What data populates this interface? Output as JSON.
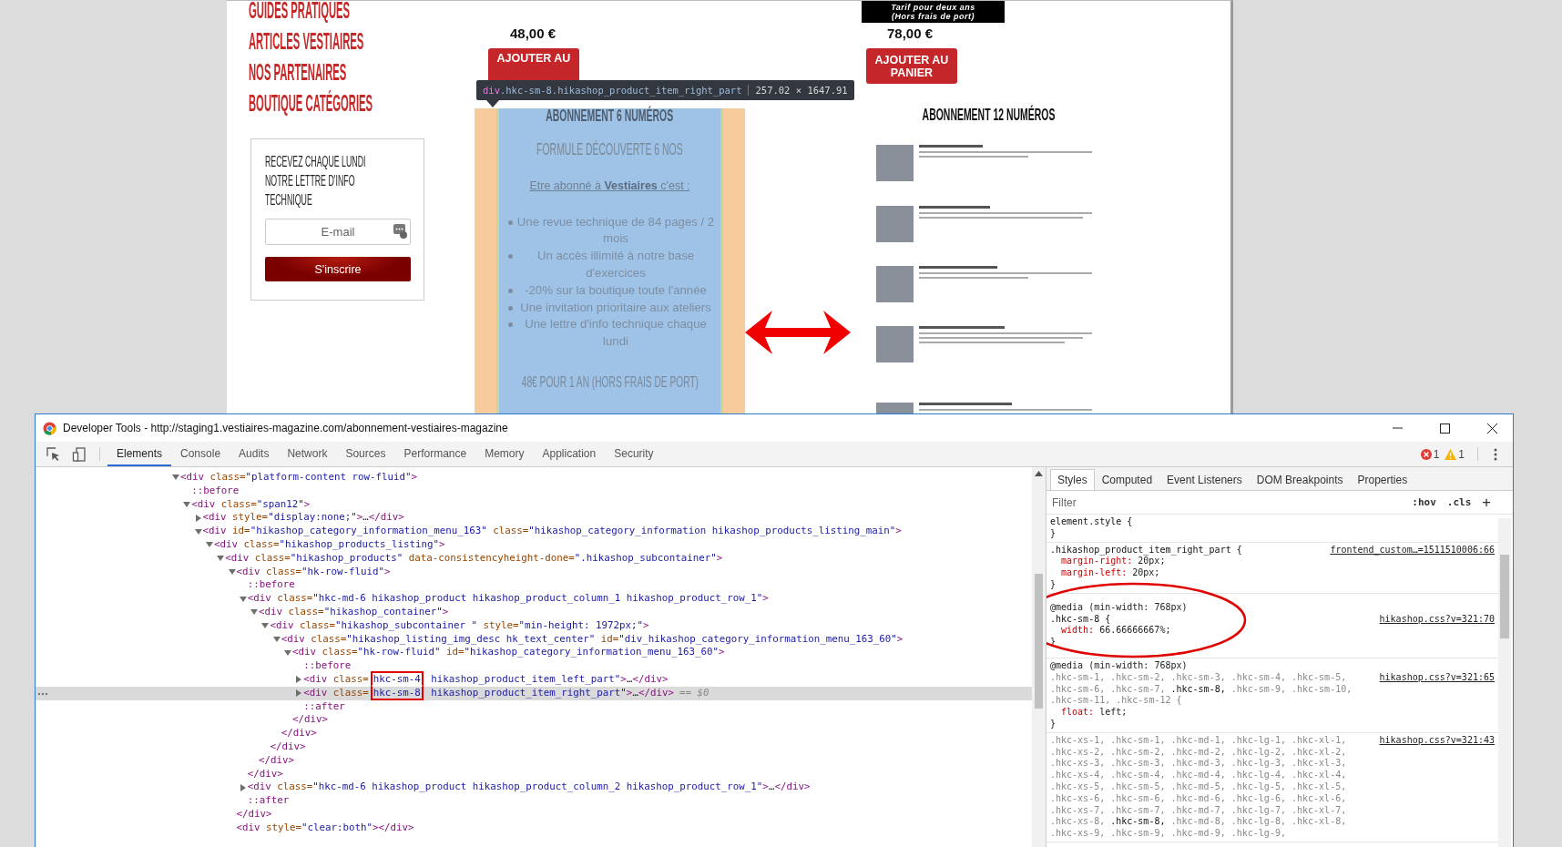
{
  "webpage": {
    "menu": [
      "GUIDES PRATIQUES",
      "ARTICLES VESTIAIRES",
      "NOS PARTENAIRES",
      "BOUTIQUE CATÉGORIES"
    ],
    "newsletter": {
      "text": "RECEVEZ CHAQUE LUNDI NOTRE LETTRE D'INFO TECHNIQUE",
      "placeholder": "E-mail",
      "button": "S'inscrire"
    },
    "products": [
      {
        "kind": "detail",
        "price": "48,00 €",
        "button": "AJOUTER AU",
        "highlighted": true,
        "title": "ABONNEMENT 6 NUMÉROS",
        "subtitle": "FORMULE DÉCOUVERTE 6 NOS",
        "intro": "Etre abonné à **Vestiaires** c'est :",
        "bullets": [
          "Une revue technique de 84 pages / 2 mois",
          "Un accès illimité à notre base d'exercices",
          "-20% sur la boutique toute l'année",
          "Une invitation prioritaire aux ateliers",
          "Une lettre d'info technique chaque lundi"
        ],
        "footer": "48€ POUR 1 AN (HORS FRAIS DE PORT)"
      },
      {
        "kind": "testimonials",
        "badge": [
          "Tarif pour deux ans",
          "(Hors frais de port)"
        ],
        "price": "78,00 €",
        "button": "AJOUTER AU PANIER",
        "highlighted": false,
        "title": "ABONNEMENT 12 NUMÉROS"
      }
    ],
    "inspect_tooltip": {
      "selector": "div.hkc-sm-8.hikashop_product_item_right_part",
      "size": "257.02 × 1647.91"
    }
  },
  "devtools": {
    "title": "Developer Tools - http://staging1.vestiaires-magazine.com/abonnement-vestiaires-magazine",
    "tabs": [
      {
        "label": "Elements",
        "selected": true
      },
      {
        "label": "Console",
        "selected": false
      },
      {
        "label": "Audits",
        "selected": false
      },
      {
        "label": "Network",
        "selected": false
      },
      {
        "label": "Sources",
        "selected": false
      },
      {
        "label": "Performance",
        "selected": false
      },
      {
        "label": "Memory",
        "selected": false
      },
      {
        "label": "Application",
        "selected": false
      },
      {
        "label": "Security",
        "selected": false
      }
    ],
    "errors": "1",
    "warnings": "1",
    "dom_tree": [
      {
        "kind": "element",
        "text": "<div class=\"platform-content row-fluid\">",
        "expanded": true,
        "selected": false,
        "children": [
          {
            "kind": "pseudo",
            "text": "::before",
            "selected": false
          },
          {
            "kind": "element",
            "text": "<div class=\"span12\">",
            "expanded": true,
            "selected": false,
            "children": [
              {
                "kind": "element",
                "text": "<div style=\"display:none;\">…</div>",
                "expanded": false,
                "selected": false
              },
              {
                "kind": "element",
                "text": "<div id=\"hikashop_category_information_menu_163\" class=\"hikashop_category_information hikashop_products_listing_main\">",
                "expanded": true,
                "selected": false,
                "children": [
                  {
                    "kind": "element",
                    "text": "<div class=\"hikashop_products_listing\">",
                    "expanded": true,
                    "selected": false,
                    "children": [
                      {
                        "kind": "element",
                        "text": "<div class=\"hikashop_products\" data-consistencyheight-done=\".hikashop_subcontainer\">",
                        "expanded": true,
                        "selected": false,
                        "children": [
                          {
                            "kind": "element",
                            "text": "<div class=\"hk-row-fluid\">",
                            "expanded": true,
                            "selected": false,
                            "close": "</div>",
                            "children": [
                              {
                                "kind": "pseudo",
                                "text": "::before",
                                "selected": false
                              },
                              {
                                "kind": "element",
                                "text": "<div class=\"hkc-md-6 hikashop_product hikashop_product_column_1 hikashop_product_row_1\">",
                                "expanded": true,
                                "selected": false,
                                "close": "</div>",
                                "children": [
                                  {
                                    "kind": "element",
                                    "text": "<div class=\"hikashop_container\">",
                                    "expanded": true,
                                    "selected": false,
                                    "close": "</div>",
                                    "children": [
                                      {
                                        "kind": "element",
                                        "text": "<div class=\"hikashop_subcontainer \" style=\"min-height: 1972px;\">",
                                        "expanded": true,
                                        "selected": false,
                                        "close": "</div>",
                                        "children": [
                                          {
                                            "kind": "element",
                                            "text": "<div class=\"hikashop_listing_img_desc hk_text_center\" id=\"div_hikashop_category_information_menu_163_60\">",
                                            "expanded": true,
                                            "selected": false,
                                            "close": "</div>",
                                            "children": [
                                              {
                                                "kind": "element",
                                                "text": "<div class=\"hk-row-fluid\" id=\"hikashop_category_information_menu_163_60\">",
                                                "expanded": true,
                                                "selected": false,
                                                "close": "</div>",
                                                "children": [
                                                  {
                                                    "kind": "pseudo",
                                                    "text": "::before",
                                                    "selected": false
                                                  },
                                                  {
                                                    "kind": "element",
                                                    "text": "<div class=",
                                                    "boxed": "hkc-sm-4",
                                                    "rest": " hikashop_product_item_left_part\">…</div>",
                                                    "expanded": false,
                                                    "selected": false
                                                  },
                                                  {
                                                    "kind": "element",
                                                    "text": "<div class=",
                                                    "boxed": "hkc-sm-8",
                                                    "rest": " hikashop_product_item_right_part\">…</div>",
                                                    "expanded": false,
                                                    "selected": true,
                                                    "console_ref": "== $0"
                                                  },
                                                  {
                                                    "kind": "pseudo",
                                                    "text": "::after",
                                                    "selected": false
                                                  }
                                                ]
                                              }
                                            ]
                                          }
                                        ]
                                      }
                                    ]
                                  }
                                ]
                              },
                              {
                                "kind": "element",
                                "text": "<div class=\"hkc-md-6 hikashop_product hikashop_product_column_2 hikashop_product_row_1\">…</div>",
                                "expanded": false,
                                "selected": false
                              },
                              {
                                "kind": "pseudo",
                                "text": "::after",
                                "selected": false
                              }
                            ]
                          },
                          {
                            "kind": "leaf",
                            "text": "<div style=\"clear:both\"></div>",
                            "selected": false
                          }
                        ]
                      }
                    ]
                  }
                ]
              }
            ]
          }
        ]
      }
    ],
    "side_tabs": [
      {
        "label": "Styles",
        "selected": true
      },
      {
        "label": "Computed",
        "selected": false
      },
      {
        "label": "Event Listeners",
        "selected": false
      },
      {
        "label": "DOM Breakpoints",
        "selected": false
      },
      {
        "label": "Properties",
        "selected": false
      }
    ],
    "filter": {
      "placeholder": "Filter"
    },
    "filter_buttons": [
      ":hov",
      ".cls",
      "+"
    ],
    "rules": [
      {
        "selectors": [
          {
            "text": "element.style {",
            "matched": true
          }
        ],
        "end": "}"
      },
      {
        "selectors": [
          {
            "text": ".hikashop_product_item_right_part {",
            "matched": true
          }
        ],
        "source": "frontend_custom…=1511510006:66",
        "props": [
          {
            "name": "margin-right:",
            "value": "20px;"
          },
          {
            "name": "margin-left:",
            "value": "20px;"
          }
        ],
        "end": "}"
      },
      {
        "media": "@media (min-width: 768px)",
        "selectors": [
          {
            "text": ".hkc-sm-8 {",
            "matched": true
          }
        ],
        "source": "hikashop.css?v=321:70",
        "props": [
          {
            "name": "width:",
            "value": "66.66666667%;"
          }
        ],
        "end": "}",
        "circled": true
      },
      {
        "media": "@media (min-width: 768px)",
        "selectors": [
          {
            "text": ".hkc-sm-1,",
            "matched": false
          },
          {
            "text": ".hkc-sm-2,",
            "matched": false
          },
          {
            "text": ".hkc-sm-3,",
            "matched": false
          },
          {
            "text": ".hkc-sm-4,",
            "matched": false
          },
          {
            "text": ".hkc-sm-5,",
            "matched": false
          },
          {
            "text": ".hkc-sm-6,",
            "matched": false
          },
          {
            "text": ".hkc-sm-7,",
            "matched": false
          },
          {
            "text": ".hkc-sm-8,",
            "matched": true
          },
          {
            "text": ".hkc-sm-9,",
            "matched": false
          },
          {
            "text": ".hkc-sm-10,",
            "matched": false
          },
          {
            "text": ".hkc-sm-11,",
            "matched": false
          },
          {
            "text": ".hkc-sm-12 {",
            "matched": false
          }
        ],
        "source": "hikashop.css?v=321:65",
        "props": [
          {
            "name": "float:",
            "value": "left;"
          }
        ],
        "end": "}"
      },
      {
        "selectors": [
          {
            "text": ".hkc-xs-1,",
            "matched": false
          },
          {
            "text": ".hkc-sm-1,",
            "matched": false
          },
          {
            "text": ".hkc-md-1,",
            "matched": false
          },
          {
            "text": ".hkc-lg-1,",
            "matched": false
          },
          {
            "text": ".hkc-xl-1,",
            "matched": false
          },
          {
            "text": ".hkc-xs-2,",
            "matched": false
          },
          {
            "text": ".hkc-sm-2,",
            "matched": false
          },
          {
            "text": ".hkc-md-2,",
            "matched": false
          },
          {
            "text": ".hkc-lg-2,",
            "matched": false
          },
          {
            "text": ".hkc-xl-2,",
            "matched": false
          },
          {
            "text": ".hkc-xs-3,",
            "matched": false
          },
          {
            "text": ".hkc-sm-3,",
            "matched": false
          },
          {
            "text": ".hkc-md-3,",
            "matched": false
          },
          {
            "text": ".hkc-lg-3,",
            "matched": false
          },
          {
            "text": ".hkc-xl-3,",
            "matched": false
          },
          {
            "text": ".hkc-xs-4,",
            "matched": false
          },
          {
            "text": ".hkc-sm-4,",
            "matched": false
          },
          {
            "text": ".hkc-md-4,",
            "matched": false
          },
          {
            "text": ".hkc-lg-4,",
            "matched": false
          },
          {
            "text": ".hkc-xl-4,",
            "matched": false
          },
          {
            "text": ".hkc-xs-5,",
            "matched": false
          },
          {
            "text": ".hkc-sm-5,",
            "matched": false
          },
          {
            "text": ".hkc-md-5,",
            "matched": false
          },
          {
            "text": ".hkc-lg-5,",
            "matched": false
          },
          {
            "text": ".hkc-xl-5,",
            "matched": false
          },
          {
            "text": ".hkc-xs-6,",
            "matched": false
          },
          {
            "text": ".hkc-sm-6,",
            "matched": false
          },
          {
            "text": ".hkc-md-6,",
            "matched": false
          },
          {
            "text": ".hkc-lg-6,",
            "matched": false
          },
          {
            "text": ".hkc-xl-6,",
            "matched": false
          },
          {
            "text": ".hkc-xs-7,",
            "matched": false
          },
          {
            "text": ".hkc-sm-7,",
            "matched": false
          },
          {
            "text": ".hkc-md-7,",
            "matched": false
          },
          {
            "text": ".hkc-lg-7,",
            "matched": false
          },
          {
            "text": ".hkc-xl-7,",
            "matched": false
          },
          {
            "text": ".hkc-xs-8,",
            "matched": false
          },
          {
            "text": ".hkc-sm-8,",
            "matched": true
          },
          {
            "text": ".hkc-md-8,",
            "matched": false
          },
          {
            "text": ".hkc-lg-8,",
            "matched": false
          },
          {
            "text": ".hkc-xl-8,",
            "matched": false
          },
          {
            "text": ".hkc-xs-9,",
            "matched": false
          },
          {
            "text": ".hkc-sm-9,",
            "matched": false
          },
          {
            "text": ".hkc-md-9,",
            "matched": false
          },
          {
            "text": ".hkc-lg-9,",
            "matched": false
          }
        ],
        "source": "hikashop.css?v=321:43"
      }
    ]
  }
}
